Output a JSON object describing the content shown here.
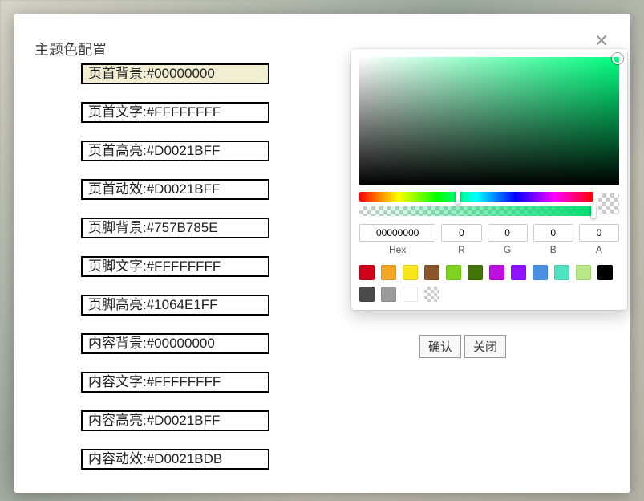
{
  "title": "主题色配置",
  "color_items": [
    {
      "label": "页首背景:#00000000",
      "sel": true
    },
    {
      "label": "页首文字:#FFFFFFFF",
      "sel": false
    },
    {
      "label": "页首高亮:#D0021BFF",
      "sel": false
    },
    {
      "label": "页首动效:#D0021BFF",
      "sel": false
    },
    {
      "label": "页脚背景:#757B785E",
      "sel": false
    },
    {
      "label": "页脚文字:#FFFFFFFF",
      "sel": false
    },
    {
      "label": "页脚高亮:#1064E1FF",
      "sel": false
    },
    {
      "label": "内容背景:#00000000",
      "sel": false
    },
    {
      "label": "内容文字:#FFFFFFFF",
      "sel": false
    },
    {
      "label": "内容高亮:#D0021BFF",
      "sel": false
    },
    {
      "label": "内容动效:#D0021BDB",
      "sel": false
    }
  ],
  "picker": {
    "hex": "00000000",
    "r": "0",
    "g": "0",
    "b": "0",
    "a": "0",
    "labels": {
      "hex": "Hex",
      "r": "R",
      "g": "G",
      "b": "B",
      "a": "A"
    },
    "preview_color": "rgba(0,0,0,0)",
    "swatches": [
      "#D0021B",
      "#F5A623",
      "#F8E71C",
      "#8B572A",
      "#7ED321",
      "#417505",
      "#BD10E0",
      "#9013FE",
      "#4A90E2",
      "#50E3C2",
      "#B8E986",
      "#000000",
      "#4A4A4A",
      "#9B9B9B",
      "#FFFFFF",
      "transparent"
    ]
  },
  "actions": {
    "confirm": "确认",
    "close": "关闭"
  }
}
